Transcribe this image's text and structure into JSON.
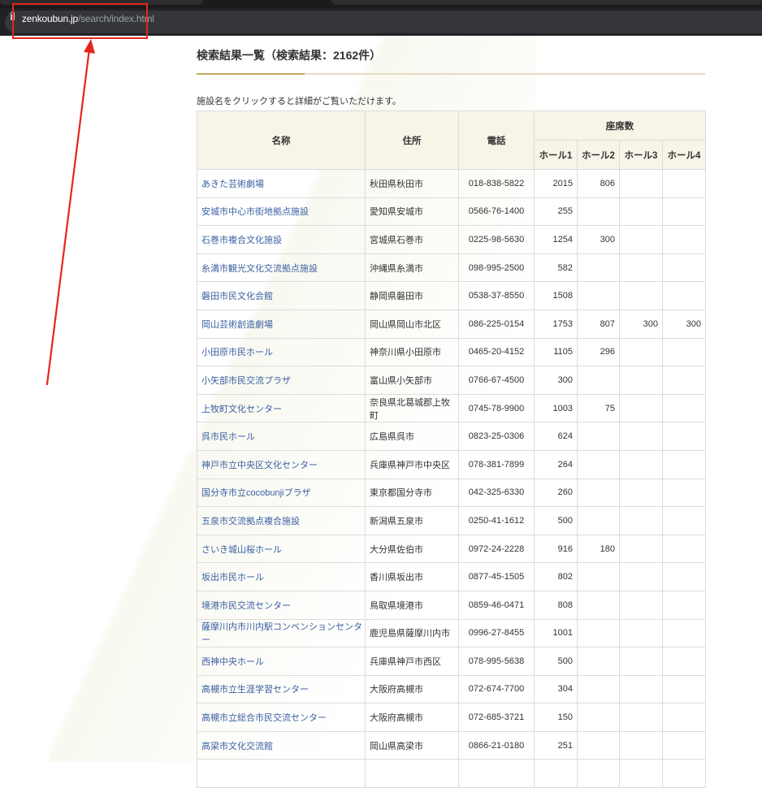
{
  "browser": {
    "url_domain": "zenkoubun.jp",
    "url_path": "/search/index.html"
  },
  "page": {
    "title": "検索結果一覧（検索結果：2162件）",
    "hint": "施設名をクリックすると詳細がご覧いただけます。"
  },
  "table": {
    "headers": {
      "name": "名称",
      "address": "住所",
      "phone": "電話",
      "seats": "座席数",
      "hall1": "ホール1",
      "hall2": "ホール2",
      "hall3": "ホール3",
      "hall4": "ホール4"
    },
    "rows": [
      {
        "name": "あきた芸術劇場",
        "address": "秋田県秋田市",
        "phone": "018-838-5822",
        "h1": "2015",
        "h2": "806",
        "h3": "",
        "h4": ""
      },
      {
        "name": "安城市中心市街地拠点施設",
        "address": "愛知県安城市",
        "phone": "0566-76-1400",
        "h1": "255",
        "h2": "",
        "h3": "",
        "h4": ""
      },
      {
        "name": "石巻市複合文化施設",
        "address": "宮城県石巻市",
        "phone": "0225-98-5630",
        "h1": "1254",
        "h2": "300",
        "h3": "",
        "h4": ""
      },
      {
        "name": "糸満市観光文化交流拠点施設",
        "address": "沖縄県糸満市",
        "phone": "098-995-2500",
        "h1": "582",
        "h2": "",
        "h3": "",
        "h4": ""
      },
      {
        "name": "磐田市民文化会館",
        "address": "静岡県磐田市",
        "phone": "0538-37-8550",
        "h1": "1508",
        "h2": "",
        "h3": "",
        "h4": ""
      },
      {
        "name": "岡山芸術創造劇場",
        "address": "岡山県岡山市北区",
        "phone": "086-225-0154",
        "h1": "1753",
        "h2": "807",
        "h3": "300",
        "h4": "300"
      },
      {
        "name": "小田原市民ホール",
        "address": "神奈川県小田原市",
        "phone": "0465-20-4152",
        "h1": "1105",
        "h2": "296",
        "h3": "",
        "h4": ""
      },
      {
        "name": "小矢部市民交流プラザ",
        "address": "富山県小矢部市",
        "phone": "0766-67-4500",
        "h1": "300",
        "h2": "",
        "h3": "",
        "h4": ""
      },
      {
        "name": "上牧町文化センター",
        "address": "奈良県北葛城郡上牧町",
        "phone": "0745-78-9900",
        "h1": "1003",
        "h2": "75",
        "h3": "",
        "h4": ""
      },
      {
        "name": "呉市民ホール",
        "address": "広島県呉市",
        "phone": "0823-25-0306",
        "h1": "624",
        "h2": "",
        "h3": "",
        "h4": ""
      },
      {
        "name": "神戸市立中央区文化センター",
        "address": "兵庫県神戸市中央区",
        "phone": "078-381-7899",
        "h1": "264",
        "h2": "",
        "h3": "",
        "h4": ""
      },
      {
        "name": "国分寺市立cocobunjiプラザ",
        "address": "東京都国分寺市",
        "phone": "042-325-6330",
        "h1": "260",
        "h2": "",
        "h3": "",
        "h4": ""
      },
      {
        "name": "五泉市交流拠点複合施設",
        "address": "新潟県五泉市",
        "phone": "0250-41-1612",
        "h1": "500",
        "h2": "",
        "h3": "",
        "h4": ""
      },
      {
        "name": "さいき城山桜ホール",
        "address": "大分県佐伯市",
        "phone": "0972-24-2228",
        "h1": "916",
        "h2": "180",
        "h3": "",
        "h4": ""
      },
      {
        "name": "坂出市民ホール",
        "address": "香川県坂出市",
        "phone": "0877-45-1505",
        "h1": "802",
        "h2": "",
        "h3": "",
        "h4": ""
      },
      {
        "name": "境港市民交流センター",
        "address": "鳥取県境港市",
        "phone": "0859-46-0471",
        "h1": "808",
        "h2": "",
        "h3": "",
        "h4": ""
      },
      {
        "name": "薩摩川内市川内駅コンベンションセンター",
        "address": "鹿児島県薩摩川内市",
        "phone": "0996-27-8455",
        "h1": "1001",
        "h2": "",
        "h3": "",
        "h4": ""
      },
      {
        "name": "西神中央ホール",
        "address": "兵庫県神戸市西区",
        "phone": "078-995-5638",
        "h1": "500",
        "h2": "",
        "h3": "",
        "h4": ""
      },
      {
        "name": "高槻市立生涯学習センター",
        "address": "大阪府高槻市",
        "phone": "072-674-7700",
        "h1": "304",
        "h2": "",
        "h3": "",
        "h4": ""
      },
      {
        "name": "高槻市立総合市民交流センター",
        "address": "大阪府高槻市",
        "phone": "072-685-3721",
        "h1": "150",
        "h2": "",
        "h3": "",
        "h4": ""
      },
      {
        "name": "高梁市文化交流館",
        "address": "岡山県高梁市",
        "phone": "0866-21-0180",
        "h1": "251",
        "h2": "",
        "h3": "",
        "h4": ""
      },
      {
        "name": "",
        "address": "",
        "phone": "",
        "h1": "",
        "h2": "",
        "h3": "",
        "h4": ""
      }
    ]
  },
  "colors": {
    "annotation_red": "#e5261e",
    "link_blue": "#3a5fa0",
    "header_bg": "#f8f4e8",
    "title_rule_gold": "#c6a85c"
  }
}
